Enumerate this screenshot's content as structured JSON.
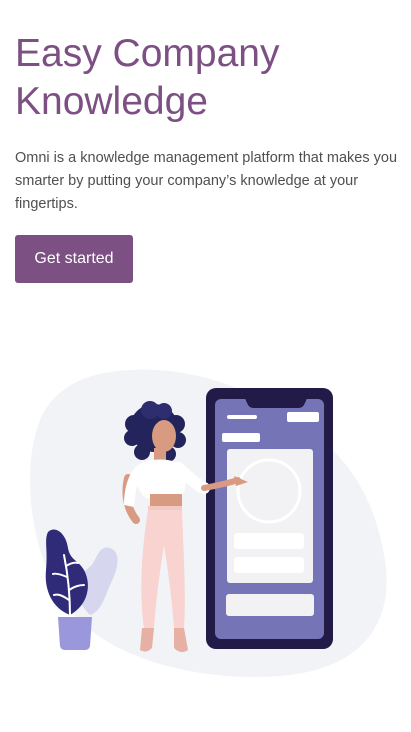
{
  "hero": {
    "title": "Easy Company Knowledge",
    "description": "Omni is a knowledge management platform that makes you smarter by putting your company’s knowledge at your fingertips.",
    "cta_label": "Get started"
  },
  "colors": {
    "accent": "#7c5083",
    "text": "#4f4f4f",
    "phone_frame": "#221a47",
    "phone_screen": "#7474b6",
    "blob": "#f2f3f6"
  },
  "illustration": {
    "icon": "woman-pointing-at-phone-illustration"
  }
}
